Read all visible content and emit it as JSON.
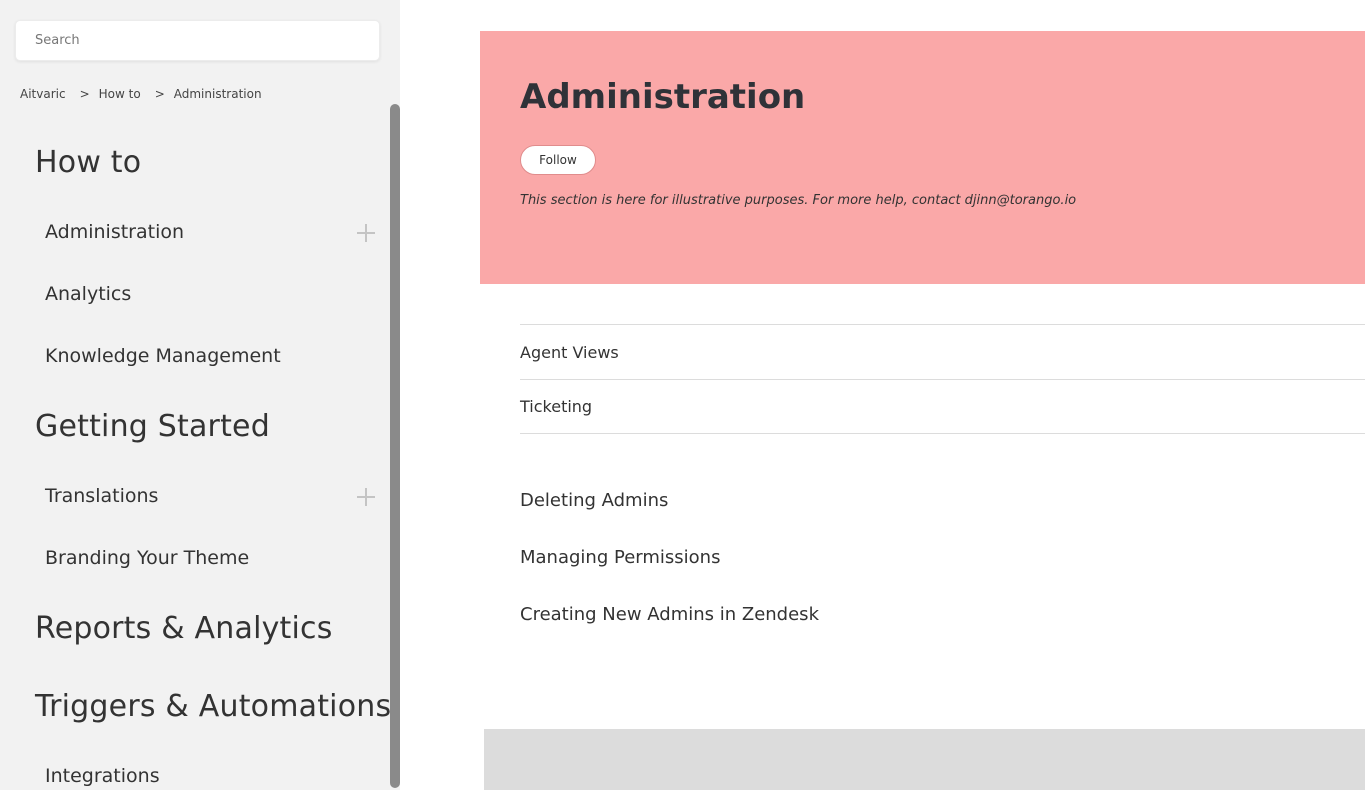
{
  "search": {
    "placeholder": "Search"
  },
  "breadcrumb": {
    "items": [
      "Aitvaric",
      "How to",
      "Administration"
    ],
    "separator": ">"
  },
  "sidebar": {
    "categories": [
      {
        "label": "How to",
        "children": [
          {
            "label": "Administration",
            "expandable": true
          },
          {
            "label": "Analytics",
            "expandable": false
          },
          {
            "label": "Knowledge Management",
            "expandable": false
          }
        ]
      },
      {
        "label": "Getting Started",
        "children": [
          {
            "label": "Translations",
            "expandable": true
          },
          {
            "label": "Branding Your Theme",
            "expandable": false
          }
        ]
      },
      {
        "label": "Reports & Analytics",
        "children": []
      },
      {
        "label": "Triggers & Automations",
        "children": [
          {
            "label": "Integrations",
            "expandable": false
          }
        ]
      }
    ]
  },
  "hero": {
    "title": "Administration",
    "follow_label": "Follow",
    "description": "This section is here for illustrative purposes. For more help, contact djinn@torango.io",
    "background_color": "#faa8a8"
  },
  "sections": [
    "Agent Views",
    "Ticketing"
  ],
  "articles": [
    "Deleting Admins",
    "Managing Permissions",
    "Creating New Admins in Zendesk"
  ],
  "icons": {
    "expand": "plus-icon"
  }
}
